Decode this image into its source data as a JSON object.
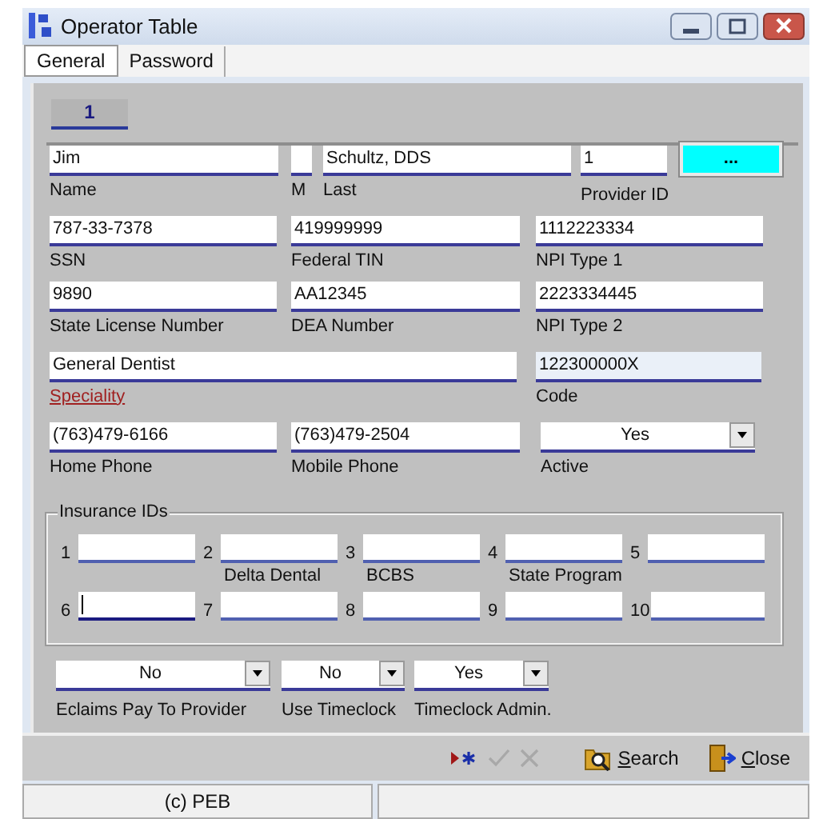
{
  "window": {
    "title": "Operator Table"
  },
  "tabs": [
    {
      "label": "General",
      "selected": true
    },
    {
      "label": "Password",
      "selected": false
    }
  ],
  "record_tab": {
    "label": "1",
    "selected": true
  },
  "form_rows": [
    [
      {
        "kind": "field",
        "value": "Jim",
        "label": "Name",
        "link": false,
        "readonly": false
      },
      {
        "kind": "field",
        "label": "M",
        "link": false,
        "readonly": false
      },
      {
        "kind": "field",
        "value": "Schultz, DDS",
        "label": "Last",
        "link": false,
        "readonly": false
      },
      {
        "kind": "field",
        "value": "1",
        "label": "Provider ID",
        "link": false,
        "readonly": false
      },
      {
        "kind": "button",
        "text": "..."
      }
    ],
    [
      {
        "kind": "field",
        "value": "787-33-7378",
        "label": "SSN",
        "link": false,
        "readonly": false
      },
      {
        "kind": "field",
        "value": "419999999",
        "label": "Federal TIN",
        "link": false,
        "readonly": false
      },
      {
        "kind": "field",
        "value": "1112223334",
        "label": "NPI Type 1",
        "link": false,
        "readonly": false
      }
    ],
    [
      {
        "kind": "field",
        "value": "9890",
        "label": "State License Number",
        "link": false,
        "readonly": false
      },
      {
        "kind": "field",
        "value": "AA12345",
        "label": "DEA Number",
        "link": false,
        "readonly": false
      },
      {
        "kind": "field",
        "value": "2223334445",
        "label": "NPI Type 2",
        "link": false,
        "readonly": false
      }
    ],
    [
      {
        "kind": "field",
        "value": "General Dentist",
        "label": "Speciality",
        "link": true,
        "readonly": false
      },
      {
        "kind": "field",
        "value": "122300000X",
        "label": "Code",
        "link": false,
        "readonly": true
      }
    ],
    [
      {
        "kind": "field",
        "value": "(763)479-6166",
        "label": "Home Phone",
        "link": false,
        "readonly": false
      },
      {
        "kind": "field",
        "value": "(763)479-2504",
        "label": "Mobile Phone",
        "link": false,
        "readonly": false
      },
      {
        "kind": "dropdown",
        "value": "Yes",
        "label": "Active"
      }
    ]
  ],
  "insurance": {
    "title": "Insurance IDs",
    "items": [
      {
        "number": "1",
        "focused": false
      },
      {
        "number": "2",
        "label": "Delta Dental",
        "focused": false
      },
      {
        "number": "3",
        "label": "BCBS",
        "focused": false
      },
      {
        "number": "4",
        "label": "State Program",
        "focused": false
      },
      {
        "number": "5",
        "focused": false
      },
      {
        "number": "6",
        "focused": true
      },
      {
        "number": "7",
        "focused": false
      },
      {
        "number": "8",
        "focused": false
      },
      {
        "number": "9",
        "focused": false
      },
      {
        "number": "10",
        "focused": false
      }
    ]
  },
  "options": [
    {
      "value": "No",
      "label": "Eclaims Pay To Provider"
    },
    {
      "value": "No",
      "label": "Use Timeclock"
    },
    {
      "value": "Yes",
      "label": "Timeclock Admin."
    }
  ],
  "toolbar": [
    {
      "kind": "new",
      "disabled": false
    },
    {
      "kind": "save",
      "disabled": true
    },
    {
      "kind": "cancel",
      "disabled": true
    },
    {
      "kind": "search",
      "label": "Search",
      "disabled": false
    },
    {
      "kind": "close",
      "label": "Close",
      "disabled": false
    }
  ],
  "status_bar": [
    "(c) PEB"
  ]
}
